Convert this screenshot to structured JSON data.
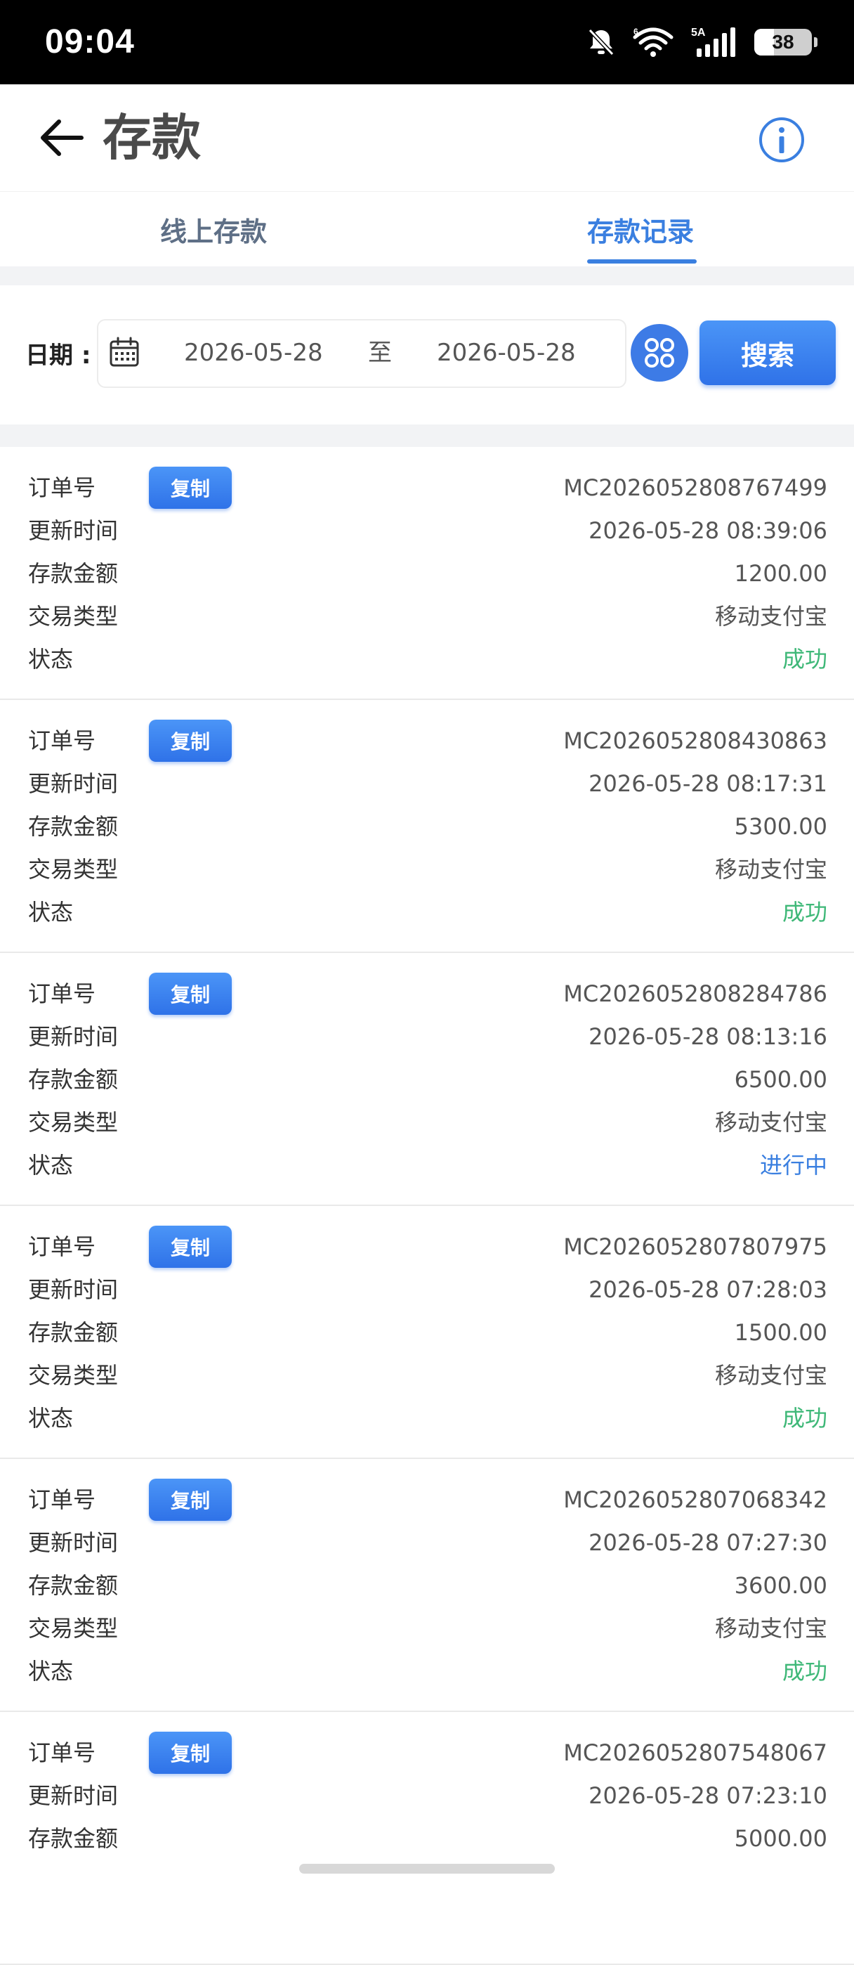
{
  "status_bar": {
    "time": "09:04",
    "battery": "38",
    "network": "5A"
  },
  "header": {
    "title": "存款"
  },
  "tabs": [
    {
      "label": "线上存款",
      "active": false
    },
    {
      "label": "存款记录",
      "active": true
    }
  ],
  "filter": {
    "date_label": "日期 :",
    "start_date": "2026-05-28",
    "separator": "至",
    "end_date": "2026-05-28",
    "search_label": "搜索"
  },
  "record_labels": {
    "order": "订单号",
    "copy": "复制",
    "updated": "更新时间",
    "amount": "存款金额",
    "type": "交易类型",
    "status": "状态"
  },
  "records": [
    {
      "order_id": "MC2026052808767499",
      "updated": "2026-05-28 08:39:06",
      "amount": "1200.00",
      "type": "移动支付宝",
      "status": "成功",
      "status_kind": "success"
    },
    {
      "order_id": "MC2026052808430863",
      "updated": "2026-05-28 08:17:31",
      "amount": "5300.00",
      "type": "移动支付宝",
      "status": "成功",
      "status_kind": "success"
    },
    {
      "order_id": "MC2026052808284786",
      "updated": "2026-05-28 08:13:16",
      "amount": "6500.00",
      "type": "移动支付宝",
      "status": "进行中",
      "status_kind": "pending"
    },
    {
      "order_id": "MC2026052807807975",
      "updated": "2026-05-28 07:28:03",
      "amount": "1500.00",
      "type": "移动支付宝",
      "status": "成功",
      "status_kind": "success"
    },
    {
      "order_id": "MC2026052807068342",
      "updated": "2026-05-28 07:27:30",
      "amount": "3600.00",
      "type": "移动支付宝",
      "status": "成功",
      "status_kind": "success"
    },
    {
      "order_id": "MC2026052807548067",
      "updated": "2026-05-28 07:23:10",
      "amount": "5000.00",
      "type": "",
      "status": "",
      "status_kind": ""
    }
  ],
  "colors": {
    "accent": "#3a7fe0",
    "success": "#3fb878"
  }
}
